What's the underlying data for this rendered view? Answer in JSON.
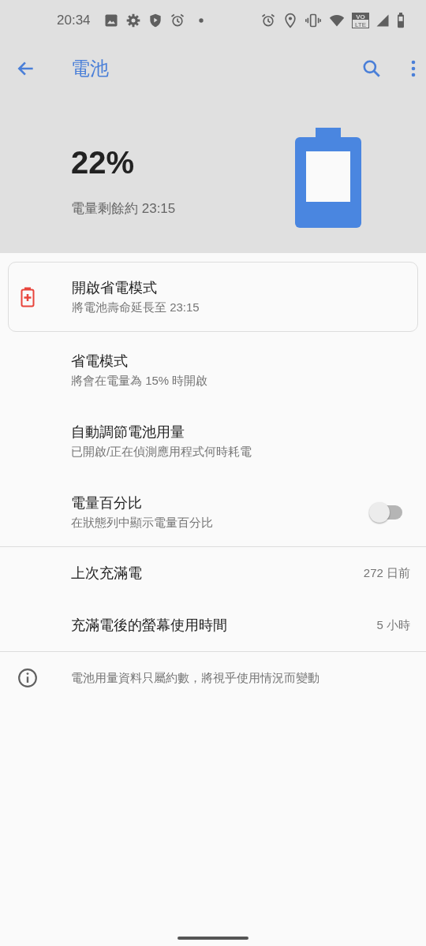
{
  "status_bar": {
    "time": "20:34",
    "network_badge": {
      "top": "VO",
      "bottom": "LTE"
    }
  },
  "toolbar": {
    "title": "電池"
  },
  "summary": {
    "percent": "22%",
    "remaining": "電量剩餘約 23:15"
  },
  "suggestion": {
    "title": "開啟省電模式",
    "subtitle": "將電池壽命延長至 23:15"
  },
  "settings": [
    {
      "kind": "text",
      "title": "省電模式",
      "subtitle": "將會在電量為 15% 時開啟"
    },
    {
      "kind": "text",
      "title": "自動調節電池用量",
      "subtitle": "已開啟/正在偵測應用程式何時耗電"
    },
    {
      "kind": "switch",
      "title": "電量百分比",
      "subtitle": "在狀態列中顯示電量百分比",
      "checked": false
    }
  ],
  "stats": [
    {
      "label": "上次充滿電",
      "value": "272 日前"
    },
    {
      "label": "充滿電後的螢幕使用時間",
      "value": "5 小時"
    }
  ],
  "footer_note": "電池用量資料只屬約數，將視乎使用情況而變動"
}
